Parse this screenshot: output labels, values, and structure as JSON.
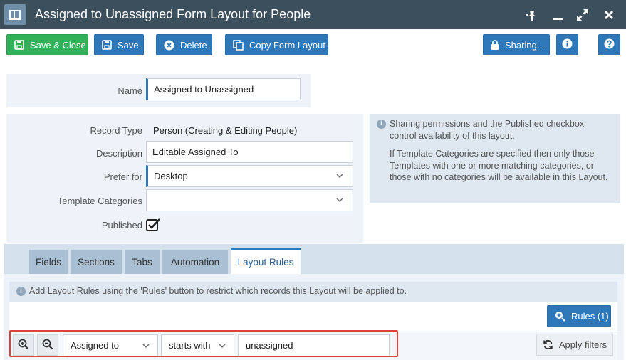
{
  "window": {
    "title": "Assigned to Unassigned Form Layout for People",
    "icons": {
      "layout": "layout-panel-icon",
      "pin": "pin-icon",
      "minimize": "minimize-icon",
      "maximize": "maximize-icon",
      "close": "close-icon"
    }
  },
  "toolbar": {
    "save_close_label": "Save & Close",
    "save_label": "Save",
    "delete_label": "Delete",
    "copy_label": "Copy Form Layout",
    "sharing_label": "Sharing...",
    "icons": {
      "save_close": "floppy-disk-icon",
      "save": "floppy-disk-icon",
      "delete": "times-circle-icon",
      "copy": "copy-icon",
      "sharing": "lock-icon",
      "info": "info-icon",
      "help": "question-icon"
    }
  },
  "form": {
    "name_label": "Name",
    "name_value": "Assigned to Unassigned",
    "record_type_label": "Record Type",
    "record_type_value": "Person (Creating & Editing People)",
    "description_label": "Description",
    "description_value": "Editable Assigned To",
    "prefer_for_label": "Prefer for",
    "prefer_for_value": "Desktop",
    "template_categories_label": "Template Categories",
    "template_categories_value": "",
    "published_label": "Published",
    "published_checked": true
  },
  "info_box": {
    "p1": "Sharing permissions and the Published checkbox control availability of this layout.",
    "p2": "If Template Categories are specified then only those Templates with one or more matching categories, or those with no categories will be available in this Layout."
  },
  "tabs": [
    {
      "label": "Fields",
      "active": false
    },
    {
      "label": "Sections",
      "active": false
    },
    {
      "label": "Tabs",
      "active": false
    },
    {
      "label": "Automation",
      "active": false
    },
    {
      "label": "Layout Rules",
      "active": true
    }
  ],
  "layout_rules": {
    "info": "Add Layout Rules using the 'Rules' button to restrict which records this Layout will be applied to.",
    "rules_button_label": "Rules (1)",
    "filter": {
      "field": "Assigned to",
      "operator": "starts with",
      "value": "unassigned"
    },
    "apply_filters_label": "Apply filters"
  },
  "colors": {
    "titlebar": "#3c4f5d",
    "primary": "#2e77b8",
    "success": "#33b15a",
    "panel": "#edf3f9",
    "highlight": "#e0413a"
  }
}
